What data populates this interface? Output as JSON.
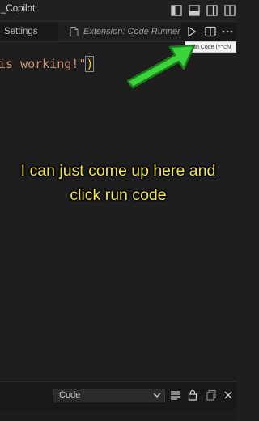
{
  "window": {
    "title": "_Copilot"
  },
  "tabs": {
    "settings_label": "Settings",
    "extension_label": "Extension: Code Runner"
  },
  "tooltip": {
    "text": "Run Code (^⌥N"
  },
  "editor": {
    "code_text": "is working!\"",
    "closing_paren": ")"
  },
  "caption": {
    "text": "I can just come up here and click run code"
  },
  "output_panel": {
    "selected_channel": "Code"
  },
  "icons": {
    "title_bar": [
      "split-left-icon",
      "panel-bottom-icon",
      "split-right-icon",
      "layout-grid-icon"
    ],
    "tab_bar": [
      "file-icon",
      "run-code-icon",
      "split-editor-icon",
      "more-actions-icon"
    ],
    "bottom_bar": [
      "chevron-down-icon",
      "filter-lines-icon",
      "lock-icon",
      "copy-icon",
      "close-panel-icon"
    ],
    "overlay": "green-arrow-icon"
  },
  "colors": {
    "background": "#1e1e1e",
    "string_color": "#ce9178",
    "bracket_color": "#ffd700",
    "caption_color": "#f2e83a",
    "arrow_color": "#3cd43c"
  }
}
